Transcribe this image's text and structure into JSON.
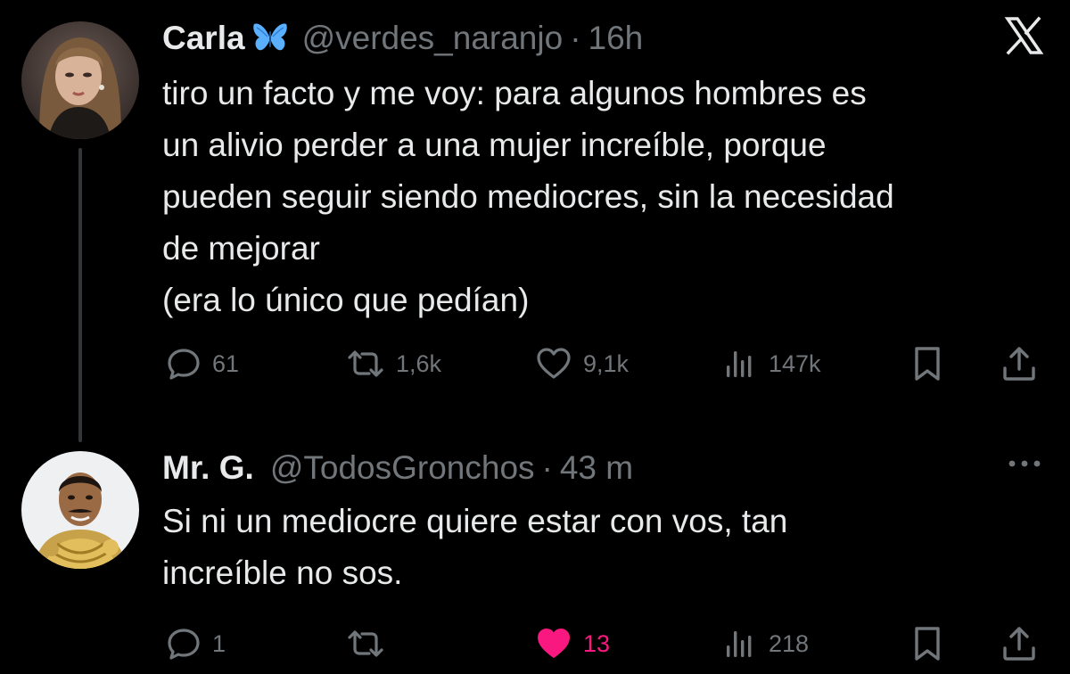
{
  "tweets": [
    {
      "display_name": "Carla",
      "badge_icon": "butterfly-emoji",
      "handle": "@verdes_naranjo",
      "separator": "·",
      "time": "16h",
      "corner_icon": "x-logo-icon",
      "text_lines": [
        "tiro un facto y me voy: para algunos hombres es",
        "un alivio perder a una mujer increíble, porque",
        "pueden seguir siendo mediocres, sin la necesidad",
        "de mejorar",
        "(era lo único que pedían)"
      ],
      "actions": {
        "replies": "61",
        "reposts": "1,6k",
        "likes": "9,1k",
        "liked": false,
        "views": "147k"
      }
    },
    {
      "display_name": "Mr. G.",
      "handle": "@TodosGronchos",
      "separator": "·",
      "time": "43 m",
      "corner_icon": "more-options-icon",
      "text_lines": [
        "Si ni un mediocre quiere estar con vos, tan",
        "increíble no sos."
      ],
      "actions": {
        "replies": "1",
        "reposts": "",
        "likes": "13",
        "liked": true,
        "views": "218"
      }
    }
  ],
  "colors": {
    "background": "#000000",
    "text": "#e7e9ea",
    "secondary": "#71767b",
    "like_active": "#f91880",
    "thread_line": "#333639",
    "butterfly": "#5ab0ff"
  }
}
